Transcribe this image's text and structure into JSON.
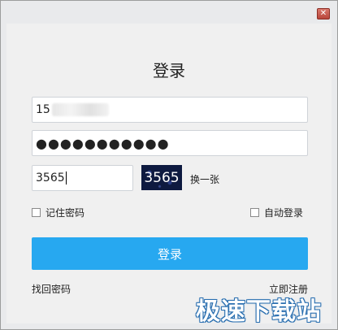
{
  "window": {
    "close_glyph": "✕"
  },
  "login": {
    "title": "登录",
    "phone_value": "15",
    "password_value": "●●●●●●●●●●●",
    "captcha_value": "3565",
    "captcha_image_text": "3565",
    "refresh_captcha_label": "换一张",
    "remember_password_label": "记住密码",
    "auto_login_label": "自动登录",
    "login_button_label": "登录",
    "forgot_password_label": "找回密码",
    "register_label": "立即注册"
  },
  "watermark": {
    "text": "极速下载站"
  },
  "colors": {
    "accent": "#27a8f0",
    "window_bg": "#e9eaec",
    "panel_bg": "#f0f0f0",
    "close_button": "#c0584b"
  },
  "icons": {
    "close": "close-icon",
    "checkbox": "checkbox-icon"
  }
}
